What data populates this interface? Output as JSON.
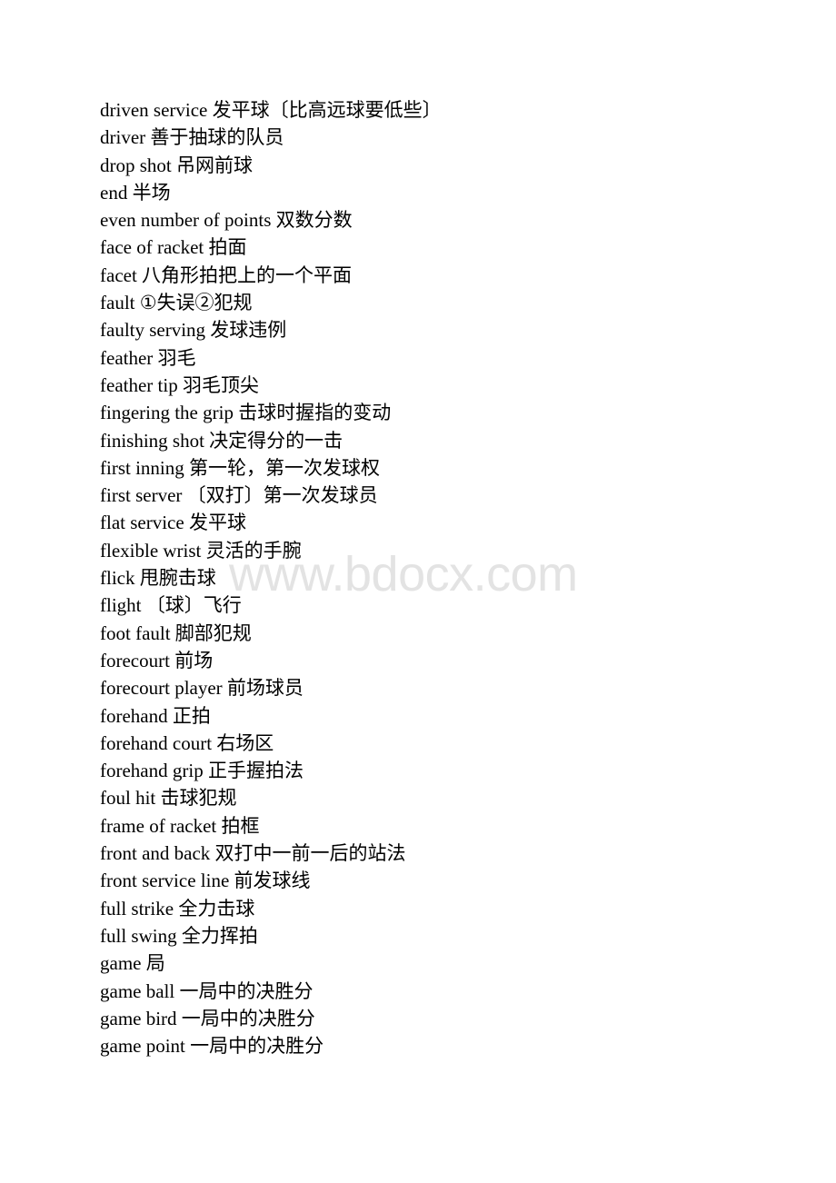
{
  "document": {
    "background_color": "#ffffff",
    "text_color": "#000000",
    "watermark": {
      "text": "www.bdocx.com",
      "color": "#e3e3e3"
    },
    "entries": [
      {
        "term": "driven service",
        "definition": "发平球〔比高远球要低些〕",
        "line": "driven service 发平球〔比高远球要低些〕"
      },
      {
        "term": "driver",
        "definition": "善于抽球的队员",
        "line": "driver 善于抽球的队员"
      },
      {
        "term": "drop shot",
        "definition": "吊网前球",
        "line": "drop shot 吊网前球"
      },
      {
        "term": "end",
        "definition": "半场",
        "line": "end 半场"
      },
      {
        "term": "even number of points",
        "definition": "双数分数",
        "line": "even number of points 双数分数"
      },
      {
        "term": "face of racket",
        "definition": "拍面",
        "line": "face of racket 拍面"
      },
      {
        "term": "facet",
        "definition": "八角形拍把上的一个平面",
        "line": "facet 八角形拍把上的一个平面"
      },
      {
        "term": "fault",
        "definition": "①失误②犯规",
        "line": "fault ①失误②犯规"
      },
      {
        "term": "faulty serving",
        "definition": "发球违例",
        "line": "faulty serving 发球违例"
      },
      {
        "term": "feather",
        "definition": "羽毛",
        "line": "feather 羽毛"
      },
      {
        "term": "feather tip",
        "definition": "羽毛顶尖",
        "line": "feather tip 羽毛顶尖"
      },
      {
        "term": "fingering the grip",
        "definition": "击球时握指的变动",
        "line": "fingering the grip 击球时握指的变动"
      },
      {
        "term": "finishing shot",
        "definition": "决定得分的一击",
        "line": "finishing shot 决定得分的一击"
      },
      {
        "term": "first inning",
        "definition": "第一轮，第一次发球权",
        "line": "first inning 第一轮，第一次发球权"
      },
      {
        "term": "first server",
        "definition": "〔双打〕第一次发球员",
        "line": "first server 〔双打〕第一次发球员"
      },
      {
        "term": "flat service",
        "definition": "发平球",
        "line": "flat service 发平球"
      },
      {
        "term": "flexible wrist",
        "definition": "灵活的手腕",
        "line": "flexible wrist 灵活的手腕"
      },
      {
        "term": "flick",
        "definition": "甩腕击球",
        "line": "flick 甩腕击球"
      },
      {
        "term": "flight",
        "definition": "〔球〕飞行",
        "line": "flight 〔球〕飞行"
      },
      {
        "term": "foot fault",
        "definition": "脚部犯规",
        "line": "foot fault 脚部犯规"
      },
      {
        "term": "forecourt",
        "definition": "前场",
        "line": "forecourt 前场"
      },
      {
        "term": "forecourt player",
        "definition": "前场球员",
        "line": "forecourt player 前场球员"
      },
      {
        "term": "forehand",
        "definition": "正拍",
        "line": "forehand 正拍"
      },
      {
        "term": "forehand court",
        "definition": "右场区",
        "line": "forehand court 右场区"
      },
      {
        "term": "forehand grip",
        "definition": "正手握拍法",
        "line": "forehand grip 正手握拍法"
      },
      {
        "term": "foul hit",
        "definition": "击球犯规",
        "line": "foul hit 击球犯规"
      },
      {
        "term": "frame of racket",
        "definition": "拍框",
        "line": "frame of racket 拍框"
      },
      {
        "term": "front and back",
        "definition": "双打中一前一后的站法",
        "line": "front and back 双打中一前一后的站法"
      },
      {
        "term": "front service line",
        "definition": "前发球线",
        "line": "front service line 前发球线"
      },
      {
        "term": "full strike",
        "definition": "全力击球",
        "line": "full strike 全力击球"
      },
      {
        "term": "full swing",
        "definition": "全力挥拍",
        "line": "full swing 全力挥拍"
      },
      {
        "term": "game",
        "definition": "局",
        "line": "game 局"
      },
      {
        "term": "game ball",
        "definition": "一局中的决胜分",
        "line": "game ball 一局中的决胜分"
      },
      {
        "term": "game bird",
        "definition": "一局中的决胜分",
        "line": "game bird 一局中的决胜分"
      },
      {
        "term": "game point",
        "definition": "一局中的决胜分",
        "line": "game point 一局中的决胜分"
      }
    ]
  }
}
